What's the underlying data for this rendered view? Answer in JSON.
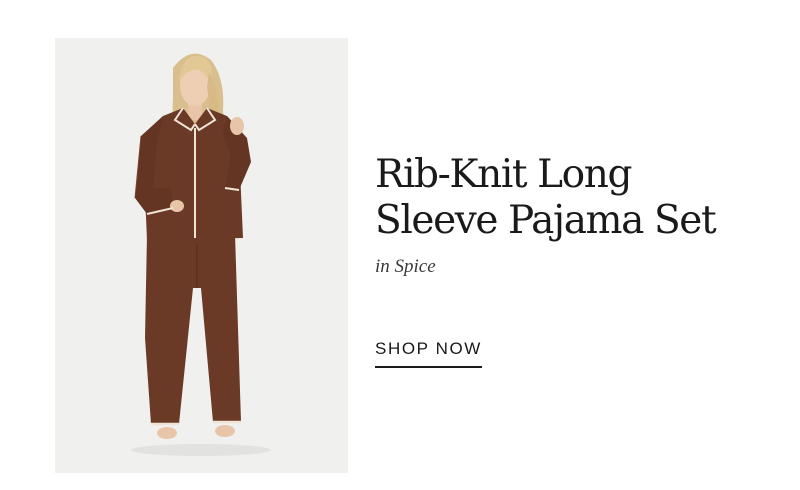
{
  "product": {
    "title_line1": "Rib-Knit Long",
    "title_line2": "Sleeve Pajama Set",
    "color_note": "in Spice",
    "cta_label": "SHOP NOW"
  },
  "colors": {
    "fabric": "#6b3a26",
    "piping": "#efe4d6",
    "background": "#f0f0ef",
    "text": "#1a1a1a"
  }
}
